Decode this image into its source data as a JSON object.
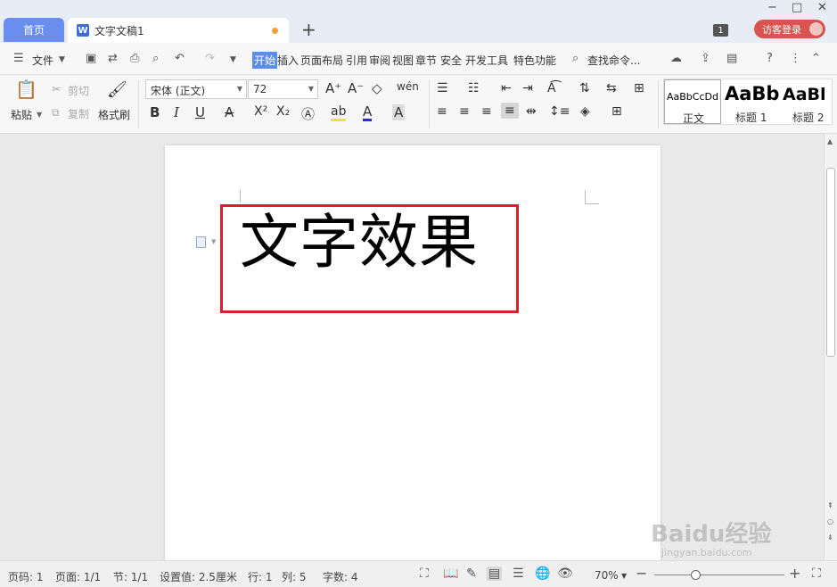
{
  "titlebar": {
    "home_tab": "首页",
    "doc_tab": "文字文稿1",
    "doc_icon": "W",
    "new_tab": "+",
    "badge": "1",
    "login": "访客登录",
    "min": "−",
    "max": "□",
    "close": "✕"
  },
  "menu": {
    "file": "文件",
    "tabs": [
      "开始",
      "插入",
      "页面布局",
      "引用",
      "审阅",
      "视图",
      "章节",
      "安全",
      "开发工具",
      "特色功能"
    ],
    "search": "查找命令..."
  },
  "ribbon": {
    "paste": "粘贴",
    "cut": "剪切",
    "copy": "复制",
    "format_painter": "格式刷",
    "font_name": "宋体 (正文)",
    "font_size": "72",
    "styles": [
      {
        "sample": "AaBbCcDd",
        "label": "正文"
      },
      {
        "sample": "AaBb",
        "label": "标题 1"
      },
      {
        "sample": "AaBl",
        "label": "标题 2"
      }
    ]
  },
  "document": {
    "text": "文字效果"
  },
  "status": {
    "page_num": "页码: 1",
    "pages": "页面: 1/1",
    "section": "节: 1/1",
    "setting": "设置值: 2.5厘米",
    "row": "行: 1",
    "col": "列: 5",
    "words": "字数: 4",
    "zoom": "70%"
  },
  "watermark": {
    "main": "Baidu经验",
    "sub": "jingyan.baidu.com"
  },
  "colors": {
    "accent": "#5b8cf0",
    "highlight_box": "#d9232a",
    "login": "#d9534f"
  }
}
